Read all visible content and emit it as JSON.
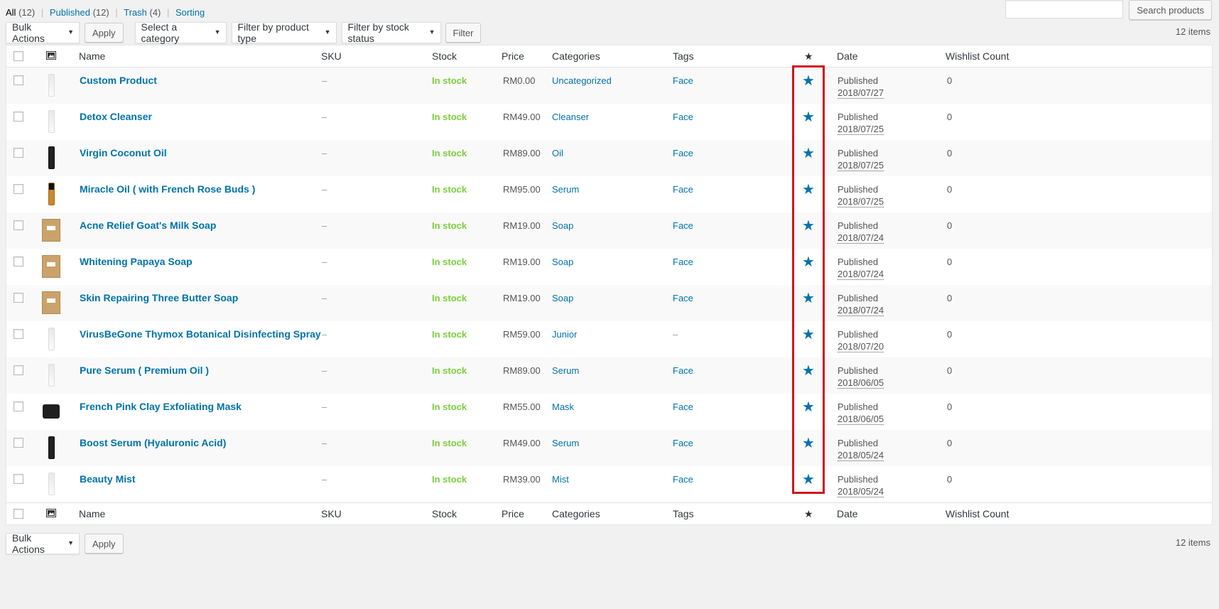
{
  "views": {
    "all_label": "All",
    "all_count": "(12)",
    "published_label": "Published",
    "published_count": "(12)",
    "trash_label": "Trash",
    "trash_count": "(4)",
    "sorting_label": "Sorting",
    "separator": "|"
  },
  "search": {
    "button_label": "Search products",
    "value": ""
  },
  "top_nav": {
    "bulk_actions": "Bulk Actions",
    "apply": "Apply",
    "category": "Select a category",
    "product_type": "Filter by product type",
    "stock_status": "Filter by stock status",
    "filter": "Filter",
    "items_count": "12 items"
  },
  "bottom_nav": {
    "bulk_actions": "Bulk Actions",
    "apply": "Apply",
    "items_count": "12 items"
  },
  "columns": {
    "name": "Name",
    "sku": "SKU",
    "stock": "Stock",
    "price": "Price",
    "categories": "Categories",
    "tags": "Tags",
    "featured": "★",
    "date": "Date",
    "wishlist": "Wishlist Count"
  },
  "products": [
    {
      "name": "Custom Product",
      "sku": "–",
      "stock": "In stock",
      "price": "RM0.00",
      "category": "Uncategorized",
      "tags": "Face",
      "featured": "★",
      "status": "Published",
      "date": "2018/07/27",
      "wishlist": "0",
      "thumb": "bottle"
    },
    {
      "name": "Detox Cleanser",
      "sku": "–",
      "stock": "In stock",
      "price": "RM49.00",
      "category": "Cleanser",
      "tags": "Face",
      "featured": "★",
      "status": "Published",
      "date": "2018/07/25",
      "wishlist": "0",
      "thumb": "bottle"
    },
    {
      "name": "Virgin Coconut Oil",
      "sku": "–",
      "stock": "In stock",
      "price": "RM89.00",
      "category": "Oil",
      "tags": "Face",
      "featured": "★",
      "status": "Published",
      "date": "2018/07/25",
      "wishlist": "0",
      "thumb": "dark"
    },
    {
      "name": "Miracle Oil ( with French Rose Buds )",
      "sku": "–",
      "stock": "In stock",
      "price": "RM95.00",
      "category": "Serum",
      "tags": "Face",
      "featured": "★",
      "status": "Published",
      "date": "2018/07/25",
      "wishlist": "0",
      "thumb": "amber"
    },
    {
      "name": "Acne Relief Goat's Milk Soap",
      "sku": "–",
      "stock": "In stock",
      "price": "RM19.00",
      "category": "Soap",
      "tags": "Face",
      "featured": "★",
      "status": "Published",
      "date": "2018/07/24",
      "wishlist": "0",
      "thumb": "soap"
    },
    {
      "name": "Whitening Papaya Soap",
      "sku": "–",
      "stock": "In stock",
      "price": "RM19.00",
      "category": "Soap",
      "tags": "Face",
      "featured": "★",
      "status": "Published",
      "date": "2018/07/24",
      "wishlist": "0",
      "thumb": "soap"
    },
    {
      "name": "Skin Repairing Three Butter Soap",
      "sku": "–",
      "stock": "In stock",
      "price": "RM19.00",
      "category": "Soap",
      "tags": "Face",
      "featured": "★",
      "status": "Published",
      "date": "2018/07/24",
      "wishlist": "0",
      "thumb": "soap"
    },
    {
      "name": "VirusBeGone Thymox Botanical Disinfecting Spray",
      "sku": "–",
      "stock": "In stock",
      "price": "RM59.00",
      "category": "Junior",
      "tags": "–",
      "featured": "★",
      "status": "Published",
      "date": "2018/07/20",
      "wishlist": "0",
      "thumb": "bottle"
    },
    {
      "name": "Pure Serum ( Premium Oil )",
      "sku": "–",
      "stock": "In stock",
      "price": "RM89.00",
      "category": "Serum",
      "tags": "Face",
      "featured": "★",
      "status": "Published",
      "date": "2018/06/05",
      "wishlist": "0",
      "thumb": "bottle"
    },
    {
      "name": "French Pink Clay Exfoliating Mask",
      "sku": "–",
      "stock": "In stock",
      "price": "RM55.00",
      "category": "Mask",
      "tags": "Face",
      "featured": "★",
      "status": "Published",
      "date": "2018/06/05",
      "wishlist": "0",
      "thumb": "jar"
    },
    {
      "name": "Boost Serum (Hyaluronic Acid)",
      "sku": "–",
      "stock": "In stock",
      "price": "RM49.00",
      "category": "Serum",
      "tags": "Face",
      "featured": "★",
      "status": "Published",
      "date": "2018/05/24",
      "wishlist": "0",
      "thumb": "dark"
    },
    {
      "name": "Beauty Mist",
      "sku": "–",
      "stock": "In stock",
      "price": "RM39.00",
      "category": "Mist",
      "tags": "Face",
      "featured": "★",
      "status": "Published",
      "date": "2018/05/24",
      "wishlist": "0",
      "thumb": "bottle"
    }
  ]
}
